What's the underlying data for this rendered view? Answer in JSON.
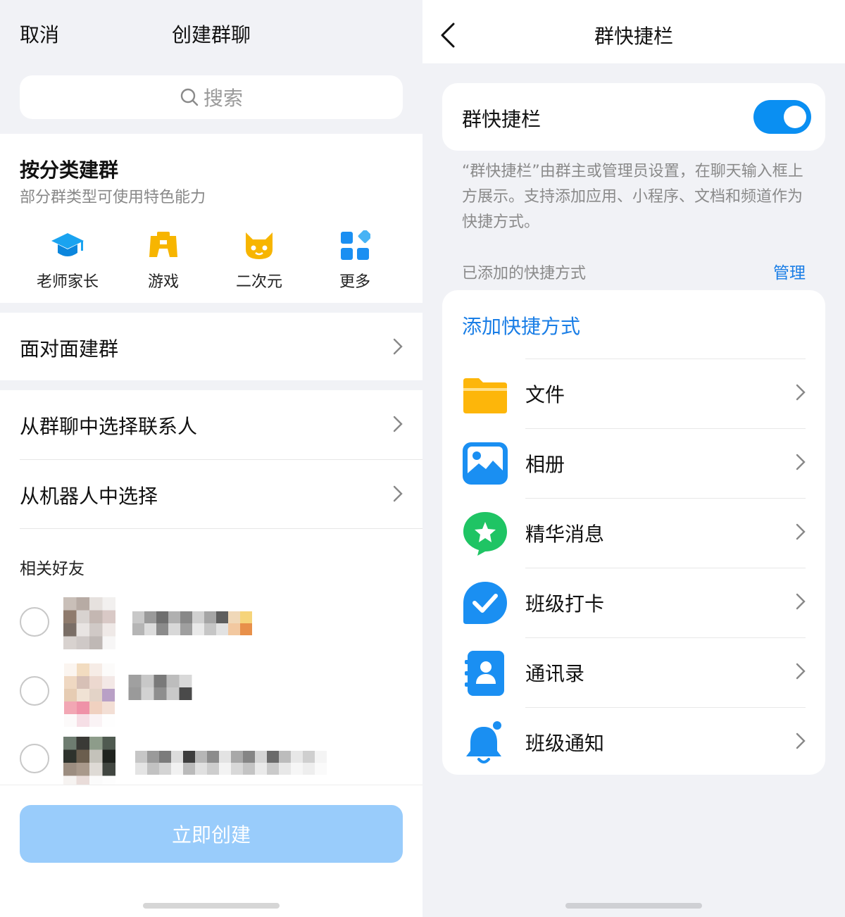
{
  "left": {
    "header": {
      "cancel": "取消",
      "title": "创建群聊"
    },
    "search": {
      "placeholder": "搜索"
    },
    "category": {
      "title": "按分类建群",
      "subtitle": "部分群类型可使用特色能力",
      "items": [
        {
          "label": "老师家长",
          "icon": "graduation-cap-icon"
        },
        {
          "label": "游戏",
          "icon": "gamepad-icon"
        },
        {
          "label": "二次元",
          "icon": "cat-face-icon"
        },
        {
          "label": "更多",
          "icon": "apps-grid-icon"
        }
      ]
    },
    "rows": {
      "face_to_face": "面对面建群",
      "from_group": "从群聊中选择联系人",
      "from_robot": "从机器人中选择"
    },
    "friends": {
      "label": "相关好友"
    },
    "create_button": "立即创建",
    "colors": {
      "accent_disabled": "#99ccfb",
      "background": "#f1f2f6"
    }
  },
  "right": {
    "header": {
      "title": "群快捷栏"
    },
    "toggle": {
      "label": "群快捷栏",
      "on": true
    },
    "description": "“群快捷栏”由群主或管理员设置，在聊天输入框上方展示。支持添加应用、小程序、文档和频道作为快捷方式。",
    "added_label": "已添加的快捷方式",
    "manage": "管理",
    "add_shortcut": "添加快捷方式",
    "items": [
      {
        "name": "文件",
        "icon": "folder-icon"
      },
      {
        "name": "相册",
        "icon": "photo-album-icon"
      },
      {
        "name": "精华消息",
        "icon": "star-message-icon"
      },
      {
        "name": "班级打卡",
        "icon": "checkin-icon"
      },
      {
        "name": "通讯录",
        "icon": "contacts-icon"
      },
      {
        "name": "班级通知",
        "icon": "bell-icon"
      }
    ],
    "colors": {
      "accent": "#1a7ee6",
      "switch_on": "#0a8ff2"
    }
  }
}
